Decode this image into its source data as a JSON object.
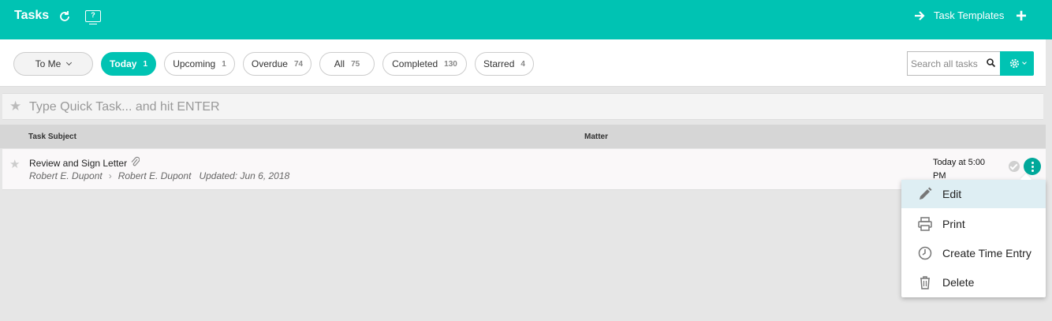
{
  "header": {
    "title": "Tasks",
    "task_templates_label": "Task Templates",
    "help_glyph": "?"
  },
  "filters": {
    "to_me": "To Me",
    "tabs": [
      {
        "label": "Today",
        "count": "1"
      },
      {
        "label": "Upcoming",
        "count": "1"
      },
      {
        "label": "Overdue",
        "count": "74"
      },
      {
        "label": "All",
        "count": "75"
      },
      {
        "label": "Completed",
        "count": "130"
      },
      {
        "label": "Starred",
        "count": "4"
      }
    ],
    "search_placeholder": "Search all tasks"
  },
  "quick_task": {
    "placeholder": "Type Quick Task... and hit ENTER"
  },
  "table": {
    "columns": [
      "Task Subject",
      "Matter"
    ],
    "rows": [
      {
        "subject": "Review and Sign Letter",
        "from": "Robert E. Dupont",
        "to": "Robert E. Dupont",
        "updated": "Updated: Jun 6, 2018",
        "due": "Today at 5:00 PM"
      }
    ]
  },
  "context_menu": {
    "items": [
      "Edit",
      "Print",
      "Create Time Entry",
      "Delete"
    ]
  },
  "colors": {
    "accent": "#00c3b3",
    "menu_highlight": "#deeef3"
  }
}
